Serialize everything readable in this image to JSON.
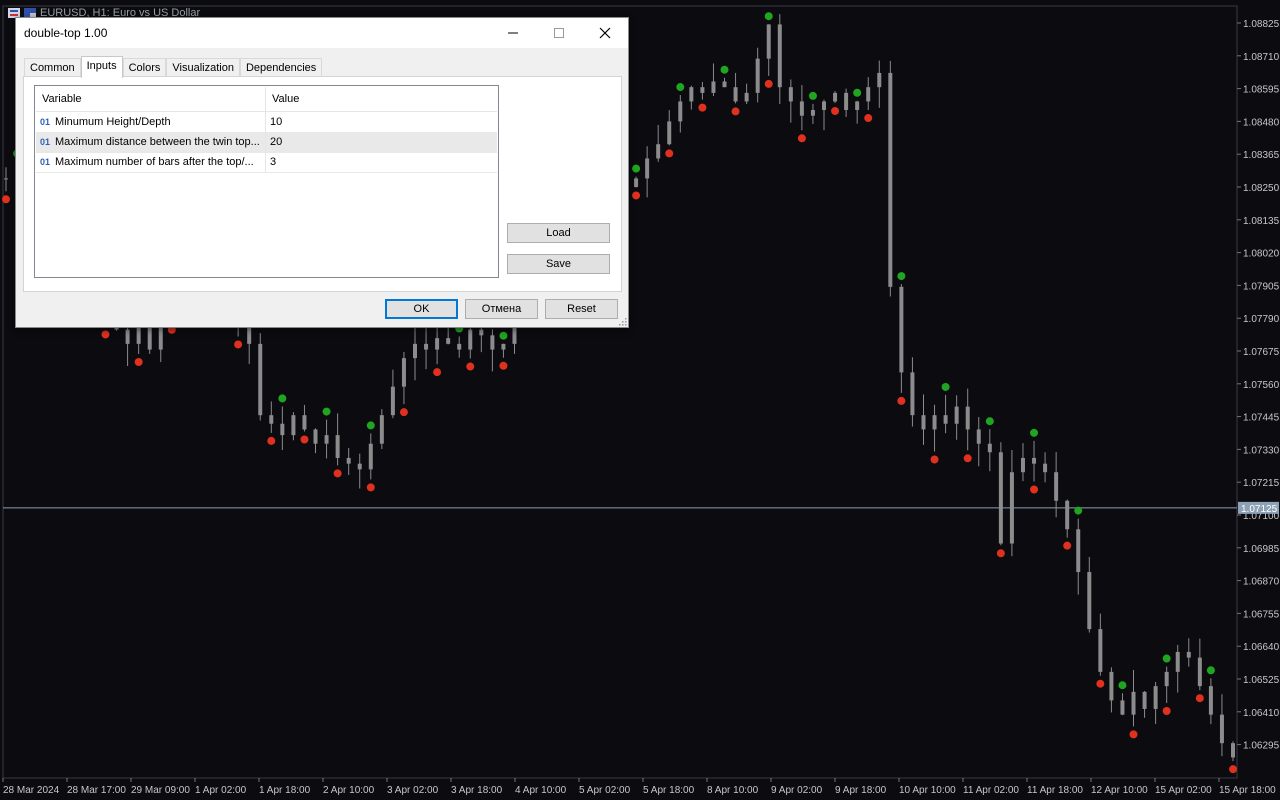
{
  "window": {
    "title": "EURUSD, H1:  Euro vs US Dollar"
  },
  "dialog": {
    "title": "double-top 1.00",
    "tabs": [
      "Common",
      "Inputs",
      "Colors",
      "Visualization",
      "Dependencies"
    ],
    "active_tab": "Inputs",
    "grid": {
      "headers": {
        "variable": "Variable",
        "value": "Value"
      },
      "rows": [
        {
          "variable": "Minumum Height/Depth",
          "value": "10",
          "type_icon": "01"
        },
        {
          "variable": "Maximum distance between the twin top...",
          "value": "20",
          "type_icon": "01"
        },
        {
          "variable": "Maximum number of bars after the top/...",
          "value": "3",
          "type_icon": "01"
        }
      ]
    },
    "buttons": {
      "load": "Load",
      "save": "Save",
      "ok": "OK",
      "cancel": "Отмена",
      "reset": "Reset"
    }
  },
  "price_axis": {
    "labels": [
      "1.08825",
      "1.08710",
      "1.08595",
      "1.08480",
      "1.08365",
      "1.08250",
      "1.08135",
      "1.08020",
      "1.07905",
      "1.07790",
      "1.07675",
      "1.07560",
      "1.07445",
      "1.07330",
      "1.07215",
      "1.07100",
      "1.06985",
      "1.06870",
      "1.06755",
      "1.06640",
      "1.06525",
      "1.06410",
      "1.06295"
    ],
    "current_price": "1.07125"
  },
  "time_axis": {
    "labels": [
      "28 Mar 2024",
      "28 Mar 17:00",
      "29 Mar 09:00",
      "1 Apr 02:00",
      "1 Apr 18:00",
      "2 Apr 10:00",
      "3 Apr 02:00",
      "3 Apr 18:00",
      "4 Apr 10:00",
      "5 Apr 02:00",
      "5 Apr 18:00",
      "8 Apr 10:00",
      "9 Apr 02:00",
      "9 Apr 18:00",
      "10 Apr 10:00",
      "11 Apr 02:00",
      "11 Apr 18:00",
      "12 Apr 10:00",
      "15 Apr 02:00",
      "15 Apr 18:00"
    ]
  },
  "colors": {
    "background": "#0b0b10",
    "candle": "#8c8c8c",
    "top_marker": "#1fa51f",
    "bottom_marker": "#e0301e",
    "axis_text": "#c8c8c8",
    "crosshair": "#8fa0b0"
  },
  "chart_data": {
    "type": "candlestick",
    "x_range": [
      "28 Mar 2024",
      "15 Apr 18:00"
    ],
    "ylim": [
      1.062,
      1.0888
    ],
    "close_path": [
      [
        0,
        1.0828
      ],
      [
        1,
        1.0833
      ],
      [
        2,
        1.082
      ],
      [
        3,
        1.0808
      ],
      [
        4,
        1.08
      ],
      [
        5,
        1.079
      ],
      [
        6,
        1.0782
      ],
      [
        7,
        1.079
      ],
      [
        8,
        1.0784
      ],
      [
        9,
        1.078
      ],
      [
        10,
        1.0775
      ],
      [
        11,
        1.077
      ],
      [
        12,
        1.0776
      ],
      [
        13,
        1.0768
      ],
      [
        14,
        1.078
      ],
      [
        15,
        1.0795
      ],
      [
        16,
        1.081
      ],
      [
        17,
        1.08
      ],
      [
        18,
        1.079
      ],
      [
        19,
        1.0785
      ],
      [
        20,
        1.078
      ],
      [
        21,
        1.079
      ],
      [
        22,
        1.077
      ],
      [
        23,
        1.0745
      ],
      [
        24,
        1.0742
      ],
      [
        25,
        1.0738
      ],
      [
        26,
        1.0745
      ],
      [
        27,
        1.074
      ],
      [
        28,
        1.0735
      ],
      [
        29,
        1.0738
      ],
      [
        30,
        1.073
      ],
      [
        31,
        1.0728
      ],
      [
        32,
        1.0726
      ],
      [
        33,
        1.0735
      ],
      [
        34,
        1.0745
      ],
      [
        35,
        1.0755
      ],
      [
        36,
        1.0765
      ],
      [
        37,
        1.077
      ],
      [
        38,
        1.0768
      ],
      [
        39,
        1.0772
      ],
      [
        40,
        1.077
      ],
      [
        41,
        1.0768
      ],
      [
        42,
        1.0775
      ],
      [
        43,
        1.0773
      ],
      [
        44,
        1.0768
      ],
      [
        45,
        1.077
      ],
      [
        46,
        1.0785
      ],
      [
        47,
        1.08
      ],
      [
        48,
        1.0815
      ],
      [
        49,
        1.0825
      ],
      [
        50,
        1.084
      ],
      [
        51,
        1.0835
      ],
      [
        52,
        1.083
      ],
      [
        53,
        1.0825
      ],
      [
        54,
        1.0835
      ],
      [
        55,
        1.083
      ],
      [
        56,
        1.0825
      ],
      [
        57,
        1.0828
      ],
      [
        58,
        1.0835
      ],
      [
        59,
        1.084
      ],
      [
        60,
        1.0848
      ],
      [
        61,
        1.0855
      ],
      [
        62,
        1.086
      ],
      [
        63,
        1.0858
      ],
      [
        64,
        1.0862
      ],
      [
        65,
        1.086
      ],
      [
        66,
        1.0855
      ],
      [
        67,
        1.0858
      ],
      [
        68,
        1.087
      ],
      [
        69,
        1.0882
      ],
      [
        70,
        1.086
      ],
      [
        71,
        1.0855
      ],
      [
        72,
        1.085
      ],
      [
        73,
        1.0852
      ],
      [
        74,
        1.0855
      ],
      [
        75,
        1.0858
      ],
      [
        76,
        1.0852
      ],
      [
        77,
        1.0855
      ],
      [
        78,
        1.086
      ],
      [
        79,
        1.0865
      ],
      [
        80,
        1.079
      ],
      [
        81,
        1.076
      ],
      [
        82,
        1.0745
      ],
      [
        83,
        1.074
      ],
      [
        84,
        1.0745
      ],
      [
        85,
        1.0742
      ],
      [
        86,
        1.0748
      ],
      [
        87,
        1.074
      ],
      [
        88,
        1.0735
      ],
      [
        89,
        1.0732
      ],
      [
        90,
        1.07
      ],
      [
        91,
        1.0725
      ],
      [
        92,
        1.073
      ],
      [
        93,
        1.0728
      ],
      [
        94,
        1.0725
      ],
      [
        95,
        1.0715
      ],
      [
        96,
        1.0705
      ],
      [
        97,
        1.069
      ],
      [
        98,
        1.067
      ],
      [
        99,
        1.0655
      ],
      [
        100,
        1.0645
      ],
      [
        101,
        1.064
      ],
      [
        102,
        1.0648
      ],
      [
        103,
        1.0642
      ],
      [
        104,
        1.065
      ],
      [
        105,
        1.0655
      ],
      [
        106,
        1.0662
      ],
      [
        107,
        1.066
      ],
      [
        108,
        1.065
      ],
      [
        109,
        1.064
      ],
      [
        110,
        1.063
      ],
      [
        111,
        1.0625
      ]
    ]
  }
}
